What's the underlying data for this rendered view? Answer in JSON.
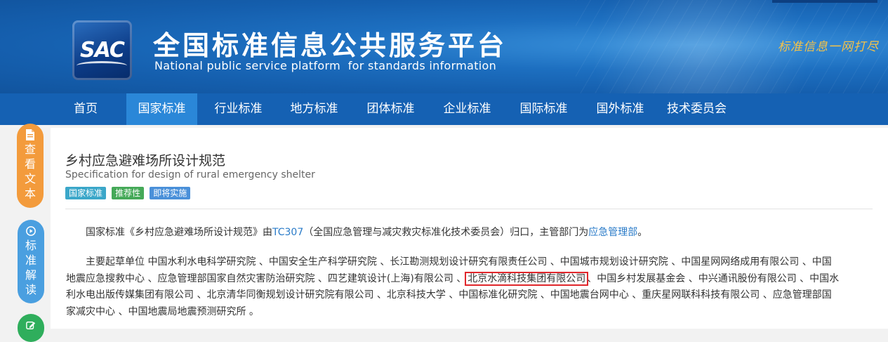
{
  "header": {
    "logo_text": "SAC",
    "site_title": "全国标准信息公共服务平台",
    "site_subtitle": "National public service platform  for standards information",
    "slogan": "标准信息一网打尽"
  },
  "nav": {
    "items": [
      {
        "label": "首页"
      },
      {
        "label": "国家标准"
      },
      {
        "label": "行业标准"
      },
      {
        "label": "地方标准"
      },
      {
        "label": "团体标准"
      },
      {
        "label": "企业标准"
      },
      {
        "label": "国际标准"
      },
      {
        "label": "国外标准"
      },
      {
        "label": "技术委员会"
      }
    ],
    "active_index": 1
  },
  "sidebar": {
    "view_text": [
      "查",
      "看",
      "文",
      "本"
    ],
    "interpret": [
      "标",
      "准",
      "解",
      "读"
    ]
  },
  "standard": {
    "title": "乡村应急避难场所设计规范",
    "title_en": "Specification for design of rural emergency shelter",
    "tags": [
      "国家标准",
      "推荐性",
      "即将实施"
    ],
    "intro": {
      "prefix": "国家标准《乡村应急避难场所设计规范》由",
      "tc_code": "TC307",
      "tc_desc": "（全国应急管理与减灾救灾标准化技术委员会）归口，主管部门为",
      "department": "应急管理部",
      "suffix": "。"
    },
    "drafters_lines": [
      "主要起草单位 中国水利水电科学研究院 、中国安全生产科学研究院 、长江勘测规划设计研究有限责任公司 、中国城市规划设计研究院 、中国星网网络成用有限公司 、中国",
      "地震应急搜救中心 、应急管理部国家自然灾害防治研究院 、四艺建筑设计(上海)有限公司 、",
      "利水电出版传媒集团有限公司 、北京清华同衡规划设计研究院有限公司 、北京科技大学 、中国标准化研究院 、中国地震台网中心 、重庆星网联科科技有限公司 、应急管理部国",
      "家减灾中心 、中国地震局地震预测研究所 。"
    ],
    "highlighted_unit": "北京水滴科技集团有限公司",
    "line2_after": "、中国乡村发展基金会 、中兴通讯股份有限公司 、中国水"
  }
}
